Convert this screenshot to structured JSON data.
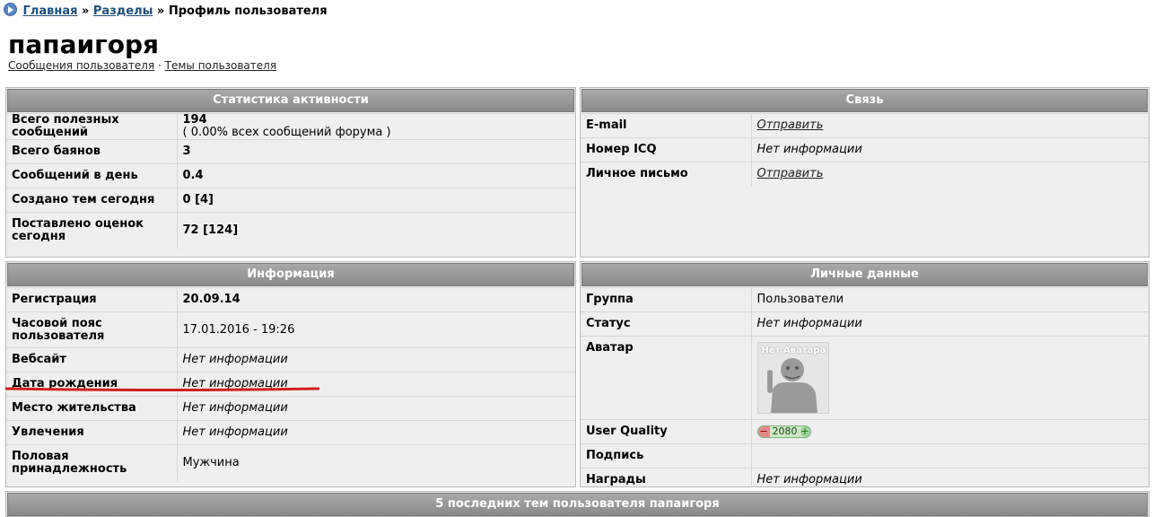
{
  "breadcrumb": {
    "home": "Главная",
    "sep1": "»",
    "sections": "Разделы",
    "sep2": "»",
    "current": "Профиль пользователя"
  },
  "user": {
    "name": "папаигоря",
    "link_posts": "Сообщения пользователя",
    "link_sep": "·",
    "link_topics": "Темы пользователя"
  },
  "activity": {
    "title": "Статистика активности",
    "rows": [
      {
        "label": "Всего полезных сообщений",
        "value": "194",
        "sub": "( 0.00% всех сообщений форума )"
      },
      {
        "label": "Всего баянов",
        "value": "3"
      },
      {
        "label": "Сообщений в день",
        "value": "0.4"
      },
      {
        "label": "Создано тем сегодня",
        "value": "0 [4]"
      },
      {
        "label": "Поставлено оценок сегодня",
        "value": "72 [124]"
      }
    ]
  },
  "contact": {
    "title": "Связь",
    "rows": [
      {
        "label": "E-mail",
        "value": "Отправить"
      },
      {
        "label": "Номер ICQ",
        "value": "Нет информации"
      },
      {
        "label": "Личное письмо",
        "value": "Отправить"
      }
    ]
  },
  "info": {
    "title": "Информация",
    "rows": [
      {
        "label": "Регистрация",
        "value": "20.09.14"
      },
      {
        "label": "Часовой пояс пользователя",
        "value": "17.01.2016 - 19:26"
      },
      {
        "label": "Вебсайт",
        "value": "Нет информации"
      },
      {
        "label": "Дата рождения",
        "value": "Нет информации"
      },
      {
        "label": "Место жительства",
        "value": "Нет информации"
      },
      {
        "label": "Увлечения",
        "value": "Нет информации"
      },
      {
        "label": "Половая принадлежность",
        "value": "Мужчина"
      }
    ]
  },
  "personal": {
    "title": "Личные данные",
    "rows": [
      {
        "label": "Группа",
        "value": "Пользователи"
      },
      {
        "label": "Статус",
        "value": "Нет информации"
      },
      {
        "label": "Аватар",
        "avatar_text": "Нет Аватара"
      },
      {
        "label": "User Quality",
        "minus": "−",
        "quality": "2080",
        "plus": "+"
      },
      {
        "label": "Подпись",
        "value": ""
      },
      {
        "label": "Награды",
        "value": "Нет информации"
      }
    ]
  },
  "topics": {
    "title": "5 последних тем пользователя папаигоря"
  },
  "colors": {
    "header_bg": "#9a9a9a",
    "panel_bg": "#efefef",
    "link": "#1f4e79",
    "red_mark": "#d21f1f"
  }
}
